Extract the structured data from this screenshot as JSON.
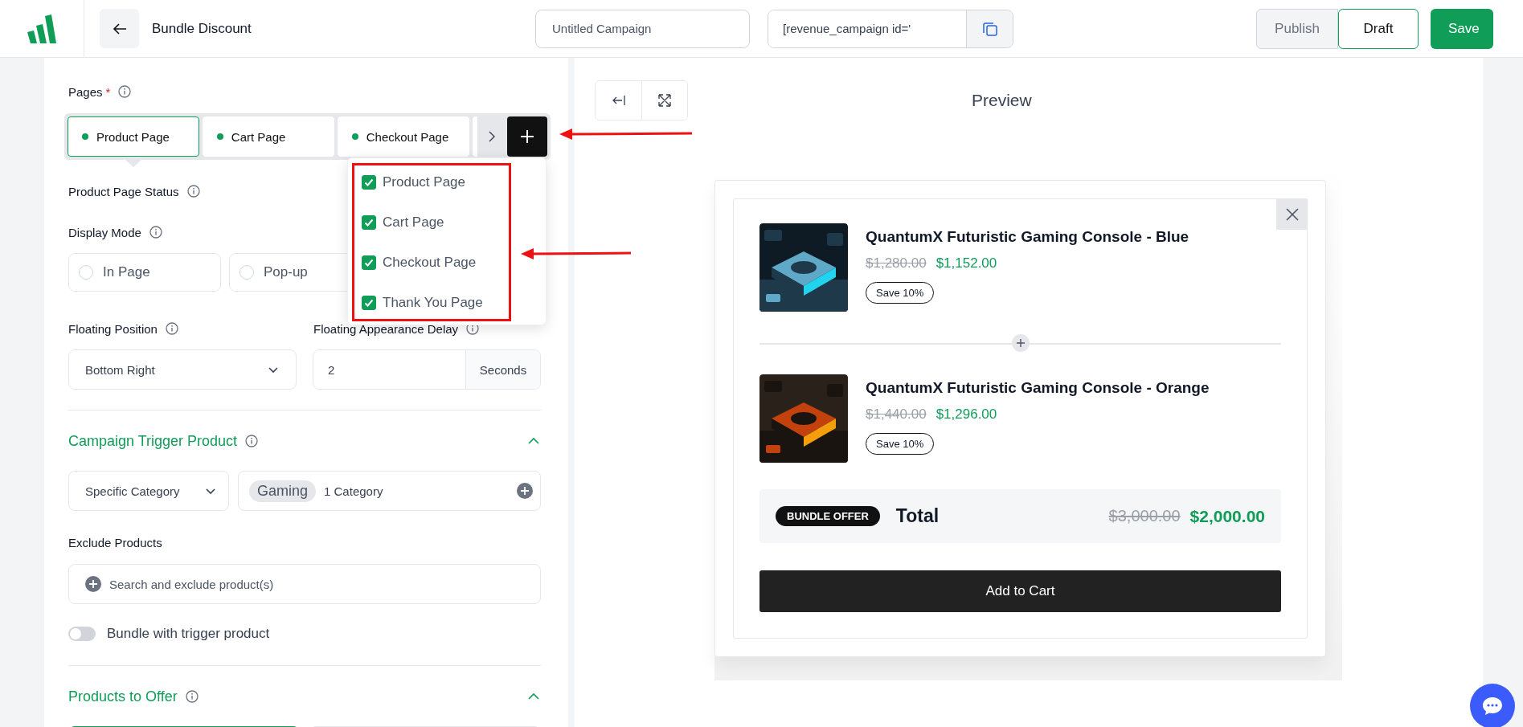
{
  "header": {
    "title": "Bundle Discount",
    "campaign_name": {
      "placeholder": "Untitled Campaign"
    },
    "shortcode": {
      "value": "[revenue_campaign id='"
    },
    "buttons": [
      {
        "label": "Publish",
        "kind": "muted"
      },
      {
        "label": "Draft",
        "kind": "outline"
      },
      {
        "label": "Save",
        "kind": "primary"
      }
    ]
  },
  "settings": {
    "pages": {
      "label": "Pages",
      "required_mark": "*",
      "tabs": [
        {
          "label": "Product Page",
          "selected": true
        },
        {
          "label": "Cart Page",
          "selected": false
        },
        {
          "label": "Checkout Page",
          "selected": false
        }
      ],
      "menu": [
        {
          "label": "Product Page",
          "checked": true
        },
        {
          "label": "Cart Page",
          "checked": true
        },
        {
          "label": "Checkout Page",
          "checked": true
        },
        {
          "label": "Thank You Page",
          "checked": true
        }
      ]
    },
    "status_label": "Product Page Status",
    "display_mode": {
      "label": "Display Mode",
      "options": [
        {
          "label": "In Page",
          "selected": false
        },
        {
          "label": "Pop-up",
          "selected": false
        }
      ]
    },
    "floating_position": {
      "label": "Floating Position",
      "value": "Bottom Right"
    },
    "appearance_delay": {
      "label": "Floating Appearance Delay",
      "value": "2",
      "unit": "Seconds"
    },
    "trigger": {
      "title": "Campaign Trigger Product",
      "expanded": true,
      "scope": "Specific Category",
      "tags": [
        "Gaming"
      ],
      "count": "1 Category"
    },
    "exclude": {
      "label": "Exclude Products",
      "placeholder": "Search and exclude product(s)"
    },
    "bundle_toggle": {
      "label": "Bundle with trigger product",
      "on": false
    },
    "offer": {
      "title": "Products to Offer",
      "expanded": true,
      "options": [
        {
          "selected": true
        },
        {
          "selected": false
        }
      ]
    }
  },
  "preview": {
    "title": "Preview",
    "products": [
      {
        "name": "QuantumX Futuristic Gaming Console - Blue",
        "old_price": "$1,280.00",
        "price": "$1,152.00",
        "badge": "Save 10%"
      },
      {
        "name": "QuantumX Futuristic Gaming Console - Orange",
        "old_price": "$1,440.00",
        "price": "$1,296.00",
        "badge": "Save 10%"
      }
    ],
    "total": {
      "badge": "BUNDLE OFFER",
      "label": "Total",
      "old_price": "$3,000.00",
      "price": "$2,000.00"
    },
    "cta": "Add to Cart"
  }
}
